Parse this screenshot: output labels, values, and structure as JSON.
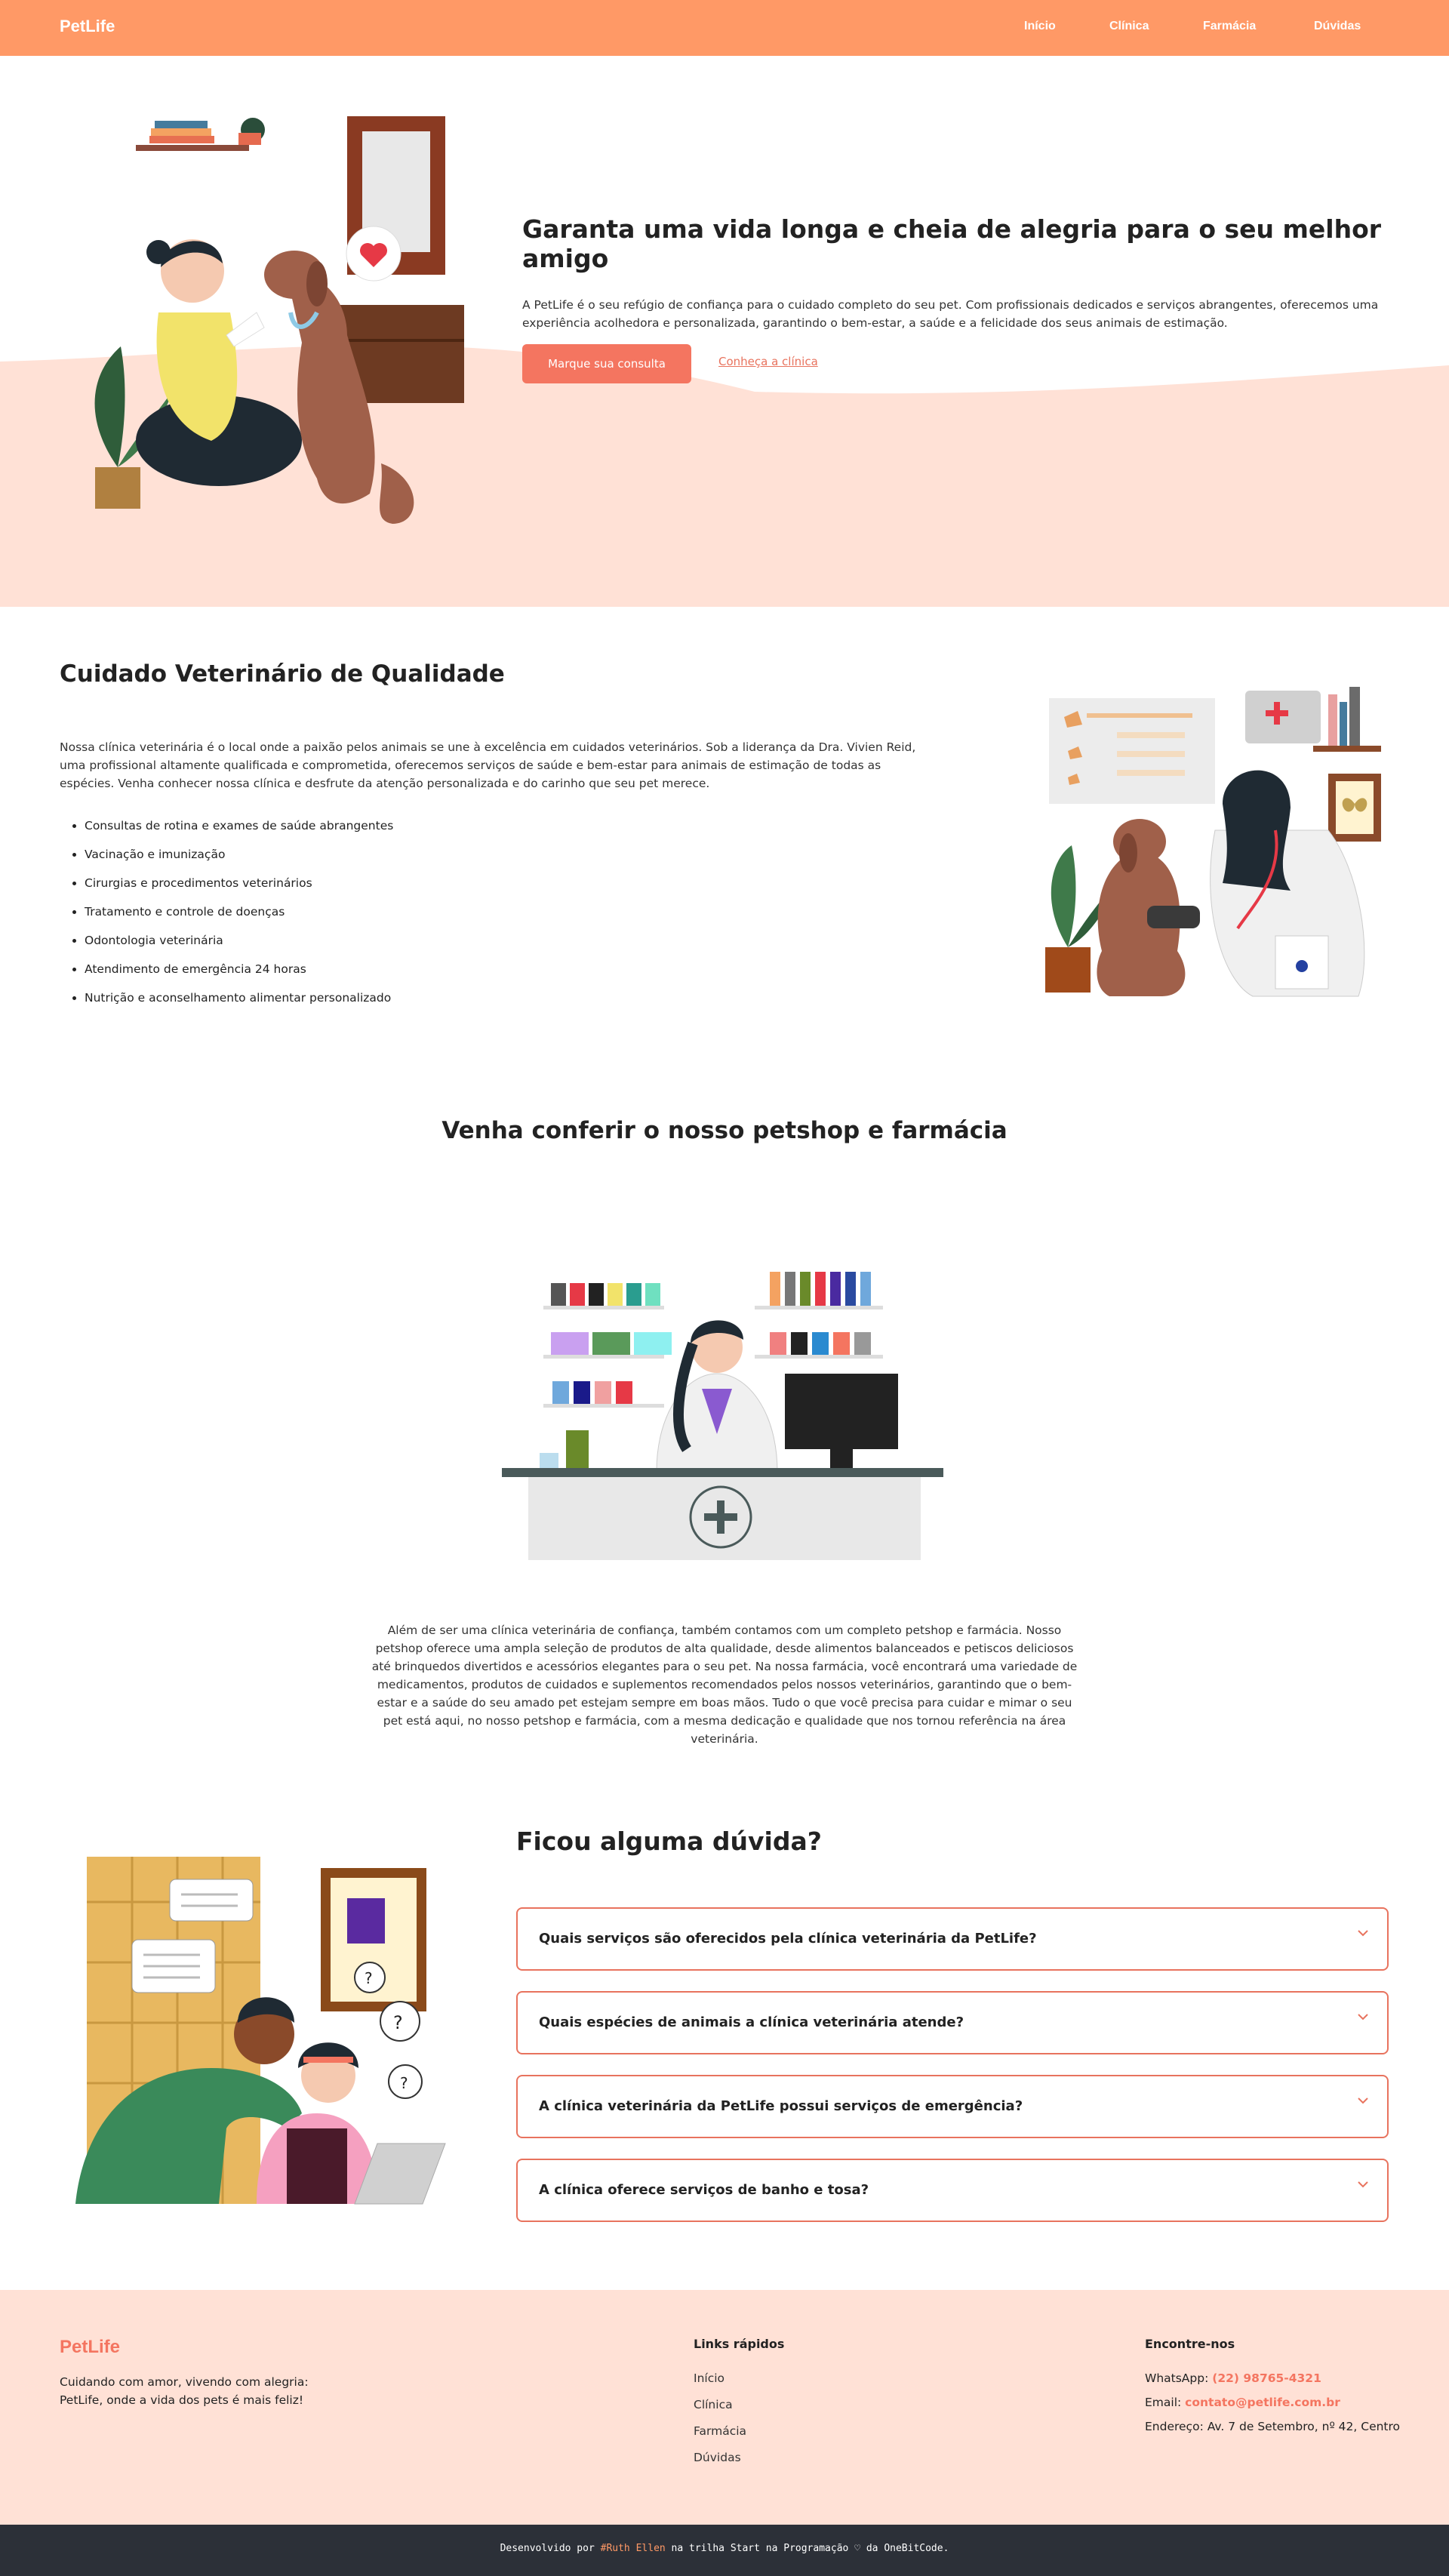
{
  "brand": {
    "name": "PetLife",
    "accent": "#ff9966",
    "primary": "#f47560"
  },
  "nav": {
    "items": [
      "Início",
      "Clínica",
      "Farmácia",
      "Dúvidas"
    ]
  },
  "hero": {
    "title": "Garanta uma vida longa e cheia de alegria para o seu melhor amigo",
    "text": "A PetLife é o seu refúgio de confiança para o cuidado completo do seu pet. Com profissionais dedicados e serviços abrangentes, oferecemos uma experiência acolhedora e personalizada, garantindo o bem-estar, a saúde e a felicidade dos seus animais de estimação.",
    "primary_button": "Marque sua consulta",
    "secondary_link": "Conheça a clínica"
  },
  "clinic": {
    "title": "Cuidado Veterinário de Qualidade",
    "text": "Nossa clínica veterinária é o local onde a paixão pelos animais se une à excelência em cuidados veterinários. Sob a liderança da Dra. Vivien Reid, uma profissional altamente qualificada e comprometida, oferecemos serviços de saúde e bem-estar para animais de estimação de todas as espécies. Venha conhecer nossa clínica e desfrute da atenção personalizada e do carinho que seu pet merece.",
    "services": [
      "Consultas de rotina e exames de saúde abrangentes",
      "Vacinação e imunização",
      "Cirurgias e procedimentos veterinários",
      "Tratamento e controle de doenças",
      "Odontologia veterinária",
      "Atendimento de emergência 24 horas",
      "Nutrição e aconselhamento alimentar personalizado"
    ]
  },
  "shop": {
    "title": "Venha conferir o nosso petshop e farmácia",
    "text": "Além de ser uma clínica veterinária de confiança, também contamos com um completo petshop e farmácia. Nosso petshop oferece uma ampla seleção de produtos de alta qualidade, desde alimentos balanceados e petiscos deliciosos até brinquedos divertidos e acessórios elegantes para o seu pet. Na nossa farmácia, você encontrará uma variedade de medicamentos, produtos de cuidados e suplementos recomendados pelos nossos veterinários, garantindo que o bem-estar e a saúde do seu amado pet estejam sempre em boas mãos. Tudo o que você precisa para cuidar e mimar o seu pet está aqui, no nosso petshop e farmácia, com a mesma dedicação e qualidade que nos tornou referência na área veterinária."
  },
  "faq": {
    "title": "Ficou alguma dúvida?",
    "items": [
      "Quais serviços são oferecidos pela clínica veterinária da PetLife?",
      "Quais espécies de animais a clínica veterinária atende?",
      "A clínica veterinária da PetLife possui serviços de emergência?",
      "A clínica oferece serviços de banho e tosa?"
    ]
  },
  "footer": {
    "tagline": "Cuidando com amor, vivendo com alegria: PetLife, onde a vida dos pets é mais feliz!",
    "links_title": "Links rápidos",
    "links": [
      "Início",
      "Clínica",
      "Farmácia",
      "Dúvidas"
    ],
    "contact_title": "Encontre-nos",
    "whatsapp_label": "WhatsApp:",
    "whatsapp": "(22) 98765-4321",
    "email_label": "Email:",
    "email": "contato@petlife.com.br",
    "address": "Endereço: Av. 7 de Setembro, nº 42, Centro",
    "credit_prefix": "Desenvolvido por",
    "credit_author": "#Ruth Ellen",
    "credit_suffix": "na trilha Start na Programação",
    "credit_heart": "♡",
    "credit_end": "da OneBitCode."
  }
}
